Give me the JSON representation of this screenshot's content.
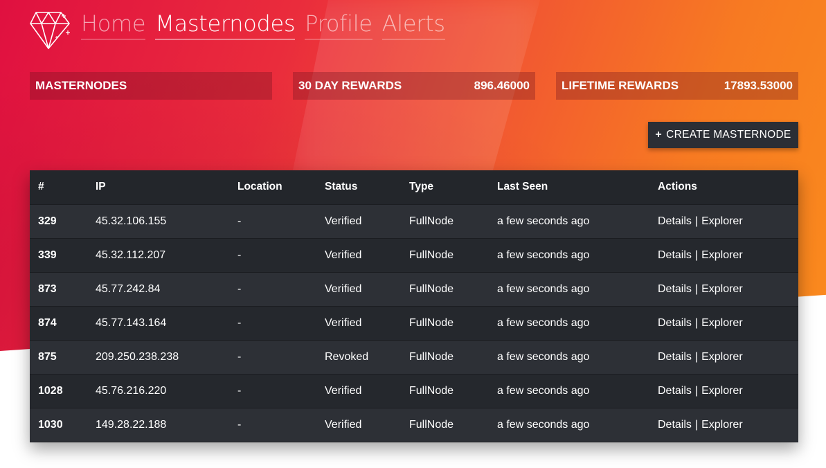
{
  "nav": {
    "items": [
      "Home",
      "Masternodes",
      "Profile",
      "Alerts"
    ],
    "active": "Masternodes"
  },
  "stats": {
    "masternodes": {
      "label": "MASTERNODES",
      "value": ""
    },
    "thirty_day": {
      "label": "30 DAY REWARDS",
      "value": "896.46000"
    },
    "lifetime": {
      "label": "LIFETIME REWARDS",
      "value": "17893.53000"
    }
  },
  "create_button": {
    "icon": "+",
    "label": "CREATE MASTERNODE"
  },
  "table": {
    "headers": [
      "#",
      "IP",
      "Location",
      "Status",
      "Type",
      "Last Seen",
      "Actions"
    ],
    "rows": [
      {
        "id": "329",
        "ip": "45.32.106.155",
        "location": "-",
        "status": "Verified",
        "type": "FullNode",
        "last_seen": "a few seconds ago"
      },
      {
        "id": "339",
        "ip": "45.32.112.207",
        "location": "-",
        "status": "Verified",
        "type": "FullNode",
        "last_seen": "a few seconds ago"
      },
      {
        "id": "873",
        "ip": "45.77.242.84",
        "location": "-",
        "status": "Verified",
        "type": "FullNode",
        "last_seen": "a few seconds ago"
      },
      {
        "id": "874",
        "ip": "45.77.143.164",
        "location": "-",
        "status": "Verified",
        "type": "FullNode",
        "last_seen": "a few seconds ago"
      },
      {
        "id": "875",
        "ip": "209.250.238.238",
        "location": "-",
        "status": "Revoked",
        "type": "FullNode",
        "last_seen": "a few seconds ago"
      },
      {
        "id": "1028",
        "ip": "45.76.216.220",
        "location": "-",
        "status": "Verified",
        "type": "FullNode",
        "last_seen": "a few seconds ago"
      },
      {
        "id": "1030",
        "ip": "149.28.22.188",
        "location": "-",
        "status": "Verified",
        "type": "FullNode",
        "last_seen": "a few seconds ago"
      }
    ],
    "actions": {
      "details": "Details",
      "separator": "|",
      "explorer": "Explorer"
    }
  },
  "icons": {
    "logo": "diamond-icon"
  },
  "colors": {
    "gradient_start": "#e01040",
    "gradient_end": "#fb8e1c",
    "table_bg": "#2d3036",
    "button_bg": "#2b2e35"
  }
}
